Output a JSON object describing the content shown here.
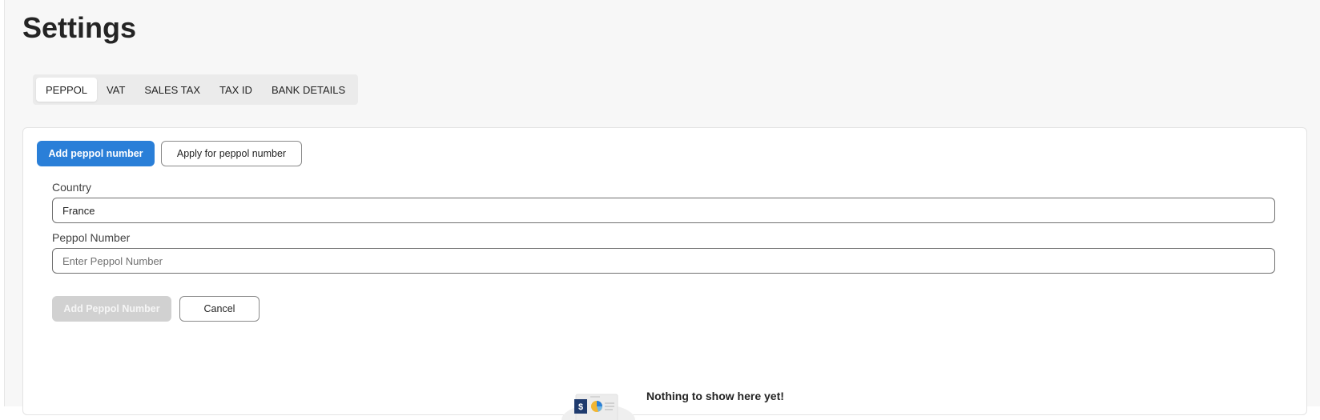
{
  "page": {
    "title": "Settings"
  },
  "tabs": [
    {
      "label": "PEPPOL",
      "active": true
    },
    {
      "label": "VAT",
      "active": false
    },
    {
      "label": "SALES TAX",
      "active": false
    },
    {
      "label": "TAX ID",
      "active": false
    },
    {
      "label": "BANK DETAILS",
      "active": false
    }
  ],
  "actions": {
    "add_peppol_label": "Add peppol number",
    "apply_peppol_label": "Apply for peppol number"
  },
  "form": {
    "country_label": "Country",
    "country_value": "France",
    "peppol_label": "Peppol Number",
    "peppol_placeholder": "Enter Peppol Number",
    "peppol_value": "",
    "submit_label": "Add Peppol Number",
    "submit_disabled": true,
    "cancel_label": "Cancel"
  },
  "empty_state": {
    "icon": "invoice-illustration-icon",
    "message": "Nothing to show here yet!"
  },
  "colors": {
    "primary": "#2a7fd8",
    "disabled": "#d1d1d1",
    "background": "#f7f7f7"
  }
}
